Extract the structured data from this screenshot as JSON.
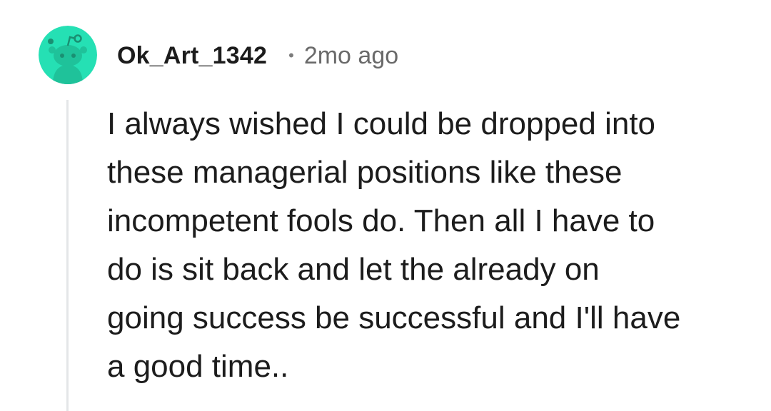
{
  "comment": {
    "author": "Ok_Art_1342",
    "separator": "•",
    "timestamp": "2mo ago",
    "avatar_icon": "reddit-snoo-avatar-icon",
    "avatar_color": "#25e0b4",
    "body_lines": [
      "I always wished I could be dropped into",
      "these managerial positions like these",
      "incompetent fools do. Then all I have to",
      "do is sit back and let the already on",
      "going success be successful and I'll have",
      "a good time.."
    ]
  }
}
